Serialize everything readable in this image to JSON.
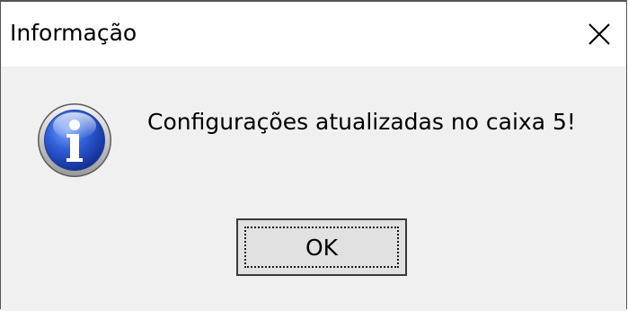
{
  "window": {
    "title": "Informação",
    "close_icon": "close-icon"
  },
  "content": {
    "icon": "information-icon",
    "message": "Configurações atualizadas no caixa 5!"
  },
  "buttons": {
    "ok_label": "OK"
  }
}
